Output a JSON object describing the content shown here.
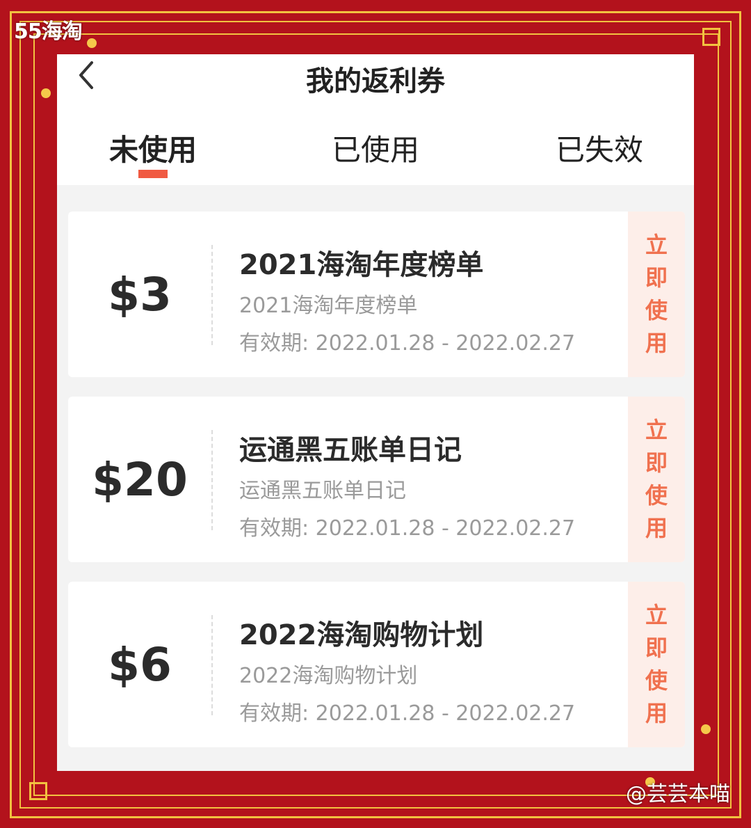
{
  "watermarks": {
    "top": "55海淘",
    "bottom": "@芸芸本喵"
  },
  "header": {
    "title": "我的返利券",
    "back_icon": "chevron-left-icon"
  },
  "tabs": [
    {
      "label": "未使用",
      "active": true
    },
    {
      "label": "已使用",
      "active": false
    },
    {
      "label": "已失效",
      "active": false
    }
  ],
  "accent_color": "#f05a42",
  "coupons": [
    {
      "amount": "$3",
      "title": "2021海淘年度榜单",
      "subtitle": "2021海淘年度榜单",
      "validity": "有效期: 2022.01.28 - 2022.02.27",
      "button": [
        "立",
        "即",
        "使",
        "用"
      ]
    },
    {
      "amount": "$20",
      "title": "运通黑五账单日记",
      "subtitle": "运通黑五账单日记",
      "validity": "有效期: 2022.01.28 - 2022.02.27",
      "button": [
        "立",
        "即",
        "使",
        "用"
      ]
    },
    {
      "amount": "$6",
      "title": "2022海淘购物计划",
      "subtitle": "2022海淘购物计划",
      "validity": "有效期: 2022.01.28 - 2022.02.27",
      "button": [
        "立",
        "即",
        "使",
        "用"
      ]
    }
  ]
}
